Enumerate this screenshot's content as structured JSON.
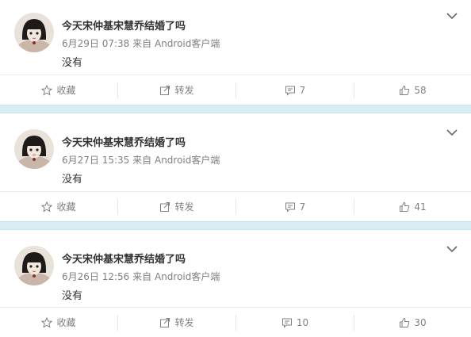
{
  "posts": [
    {
      "username": "今天宋仲基宋慧乔结婚了吗",
      "date": "6月29日 07:38",
      "source_prefix": "来自",
      "source": "Android客户端",
      "text": "没有",
      "favorite_label": "收藏",
      "repost_label": "转发",
      "comments": "7",
      "likes": "58"
    },
    {
      "username": "今天宋仲基宋慧乔结婚了吗",
      "date": "6月27日 15:35",
      "source_prefix": "来自",
      "source": "Android客户端",
      "text": "没有",
      "favorite_label": "收藏",
      "repost_label": "转发",
      "comments": "7",
      "likes": "41"
    },
    {
      "username": "今天宋仲基宋慧乔结婚了吗",
      "date": "6月26日 12:56",
      "source_prefix": "来自",
      "source": "Android客户端",
      "text": "没有",
      "favorite_label": "收藏",
      "repost_label": "转发",
      "comments": "10",
      "likes": "30"
    }
  ],
  "icons": {
    "favorite": "star-icon",
    "repost": "share-icon",
    "comment": "comment-icon",
    "like": "thumbs-up-icon",
    "menu": "chevron-down-icon"
  },
  "colors": {
    "separator": "#d9edf7",
    "muted_text": "#808080",
    "text": "#333333"
  }
}
